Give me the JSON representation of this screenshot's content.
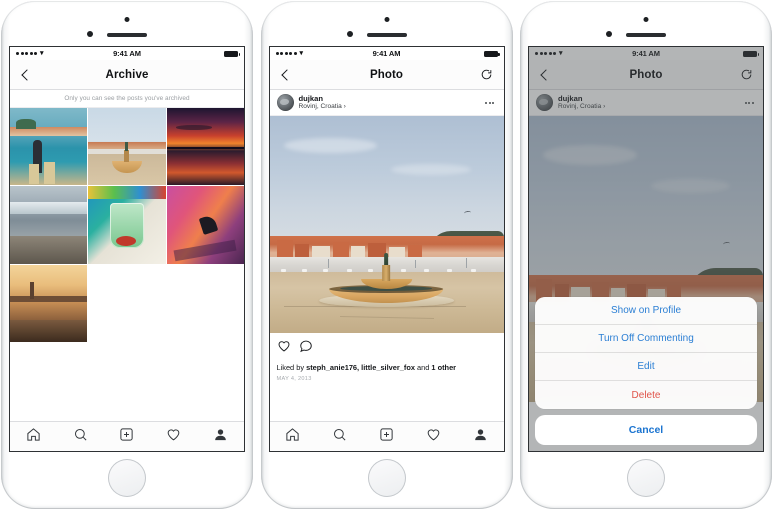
{
  "phones": [
    {
      "id": "phone-archive",
      "status_bar": {
        "time": "9:41 AM",
        "signal_dots": 5,
        "wifi_icon": "wifi-icon",
        "battery_icon": "battery-full-icon"
      },
      "nav": {
        "back_icon": "chevron-left-icon",
        "title": "Archive",
        "right_icon": ""
      },
      "banner": "Only you can see the posts you've archived",
      "grid": [
        {
          "name": "photo-man-harbor"
        },
        {
          "name": "photo-fountain-square"
        },
        {
          "name": "photo-sunset-sea"
        },
        {
          "name": "photo-rocky-coast"
        },
        {
          "name": "photo-mojito-drink"
        },
        {
          "name": "photo-pink-sunset-boat"
        },
        {
          "name": "photo-golden-town-dusk"
        }
      ],
      "tabbar": [
        {
          "name": "tab-home",
          "icon": "home-icon"
        },
        {
          "name": "tab-search",
          "icon": "search-icon"
        },
        {
          "name": "tab-add",
          "icon": "plus-square-icon"
        },
        {
          "name": "tab-activity",
          "icon": "heart-icon"
        },
        {
          "name": "tab-profile",
          "icon": "person-filled-icon"
        }
      ]
    },
    {
      "id": "phone-photo",
      "status_bar": {
        "time": "9:41 AM",
        "signal_dots": 5,
        "wifi_icon": "wifi-icon",
        "battery_icon": "battery-full-icon"
      },
      "nav": {
        "back_icon": "chevron-left-icon",
        "title": "Photo",
        "right_icon": "refresh-icon"
      },
      "post": {
        "username": "dujkan",
        "location": "Rovinj, Croatia ›",
        "more_icon": "ellipsis-icon",
        "photo_name": "photo-fountain-rovinj",
        "like_icon": "heart-icon",
        "comment_icon": "comment-icon",
        "liked_by_prefix": "Liked by ",
        "liked_by_names": "steph_anie176, little_silver_fox",
        "liked_by_join": " and ",
        "liked_by_more": "1 other",
        "date": "MAY 4, 2013"
      },
      "tabbar": [
        {
          "name": "tab-home",
          "icon": "home-icon"
        },
        {
          "name": "tab-search",
          "icon": "search-icon"
        },
        {
          "name": "tab-add",
          "icon": "plus-square-icon"
        },
        {
          "name": "tab-activity",
          "icon": "heart-icon"
        },
        {
          "name": "tab-profile",
          "icon": "person-filled-icon"
        }
      ]
    },
    {
      "id": "phone-action-sheet",
      "status_bar": {
        "time": "9:41 AM",
        "signal_dots": 5,
        "wifi_icon": "wifi-icon",
        "battery_icon": "battery-full-icon"
      },
      "nav": {
        "back_icon": "chevron-left-icon",
        "title": "Photo",
        "right_icon": "refresh-icon"
      },
      "post": {
        "username": "dujkan",
        "location": "Rovinj, Croatia ›",
        "more_icon": "ellipsis-icon",
        "photo_name": "photo-fountain-rovinj"
      },
      "action_sheet": {
        "items": [
          {
            "name": "show-on-profile",
            "label": "Show on Profile",
            "style": "default"
          },
          {
            "name": "turn-off-commenting",
            "label": "Turn Off Commenting",
            "style": "default"
          },
          {
            "name": "edit",
            "label": "Edit",
            "style": "default"
          },
          {
            "name": "delete",
            "label": "Delete",
            "style": "destructive"
          }
        ],
        "cancel_label": "Cancel"
      }
    }
  ],
  "colors": {
    "ios_blue": "#2b7fd4",
    "destructive_red": "#e0544a",
    "cancel_blue": "#1b74d0",
    "text_primary": "#16181b",
    "text_muted": "#9a9ea2",
    "device_body": "#ffffff",
    "screen_border": "#2e3134"
  }
}
